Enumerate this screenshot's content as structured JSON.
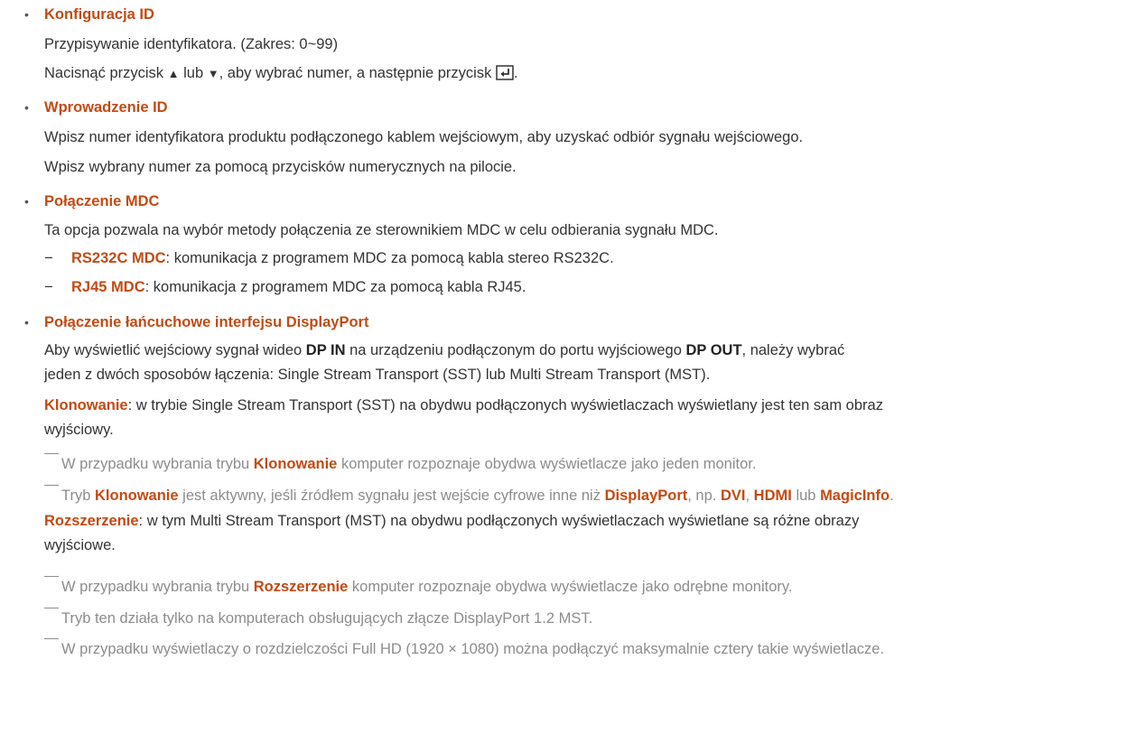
{
  "items": [
    {
      "title": "Konfiguracja ID",
      "line1": "Przypisywanie identyfikatora. (Zakres: 0~99)",
      "line2": {
        "pre": "Nacisnąć przycisk",
        "up": "▲",
        "mid": "lub",
        "down": "▼",
        "post": ", aby wybrać numer, a następnie przycisk",
        "end": ".",
        "enter_icon": "enter-key-icon"
      }
    },
    {
      "title": "Wprowadzenie ID",
      "line1": "Wpisz numer identyfikatora produktu podłączonego kablem wejściowym, aby uzyskać odbiór sygnału wejściowego.",
      "line2": "Wpisz wybrany numer za pomocą przycisków numerycznych na pilocie."
    },
    {
      "title": "Połączenie MDC",
      "line1": "Ta opcja pozwala na wybór metody połączenia ze sterownikiem MDC w celu odbierania sygnału MDC.",
      "sub": [
        {
          "dash": "−",
          "name": "RS232C MDC",
          "text": ": komunikacja z programem MDC za pomocą kabla stereo RS232C."
        },
        {
          "dash": "−",
          "name": "RJ45 MDC",
          "text": ": komunikacja z programem MDC za pomocą kabla RJ45."
        }
      ]
    },
    {
      "title": "Połączenie łańcuchowe interfejsu DisplayPort",
      "intro": {
        "a": "Aby wyświetlić wejściowy sygnał wideo",
        "dp_in": "DP IN",
        "b": "na urządzeniu podłączonym do portu wyjściowego",
        "dp_out": "DP OUT",
        "c": ", należy wybrać",
        "line2": "jeden z dwóch sposobów łączenia: Single Stream Transport (SST) lub Multi Stream Transport (MST)."
      },
      "clone": {
        "label": "Klonowanie",
        "text": ": w trybie Single Stream Transport (SST) na obydwu podłączonych wyświetlaczach wyświetlany jest ten sam obraz",
        "text2": "wyjściowy."
      },
      "clone_notes": {
        "n1": {
          "a": "W przypadku wybrania trybu",
          "b": "Klonowanie",
          "c": "komputer rozpoznaje obydwa wyświetlacze jako jeden monitor."
        },
        "n2": {
          "a": "Tryb",
          "b": "Klonowanie",
          "c": "jest aktywny, jeśli źródłem sygnału jest wejście cyfrowe inne niż",
          "d": "DisplayPort",
          "e": ", np.",
          "f": "DVI",
          "g": ",",
          "h": "HDMI",
          "i": "lub",
          "j": "MagicInfo",
          "k": "."
        }
      },
      "extend": {
        "label": "Rozszerzenie",
        "text": ": w tym Multi Stream Transport (MST) na obydwu podłączonych wyświetlaczach wyświetlane są różne obrazy",
        "text2": "wyjściowe."
      },
      "extend_notes": {
        "n1": {
          "a": "W przypadku wybrania trybu",
          "b": "Rozszerzenie",
          "c": "komputer rozpoznaje obydwa wyświetlacze jako odrębne monitory."
        },
        "n2": "Tryb ten działa tylko na komputerach obsługujących złącze DisplayPort 1.2 MST.",
        "n3": "W przypadku wyświetlaczy o rozdzielczości Full HD (1920 × 1080) można podłączyć maksymalnie cztery takie wyświetlacze."
      }
    }
  ]
}
